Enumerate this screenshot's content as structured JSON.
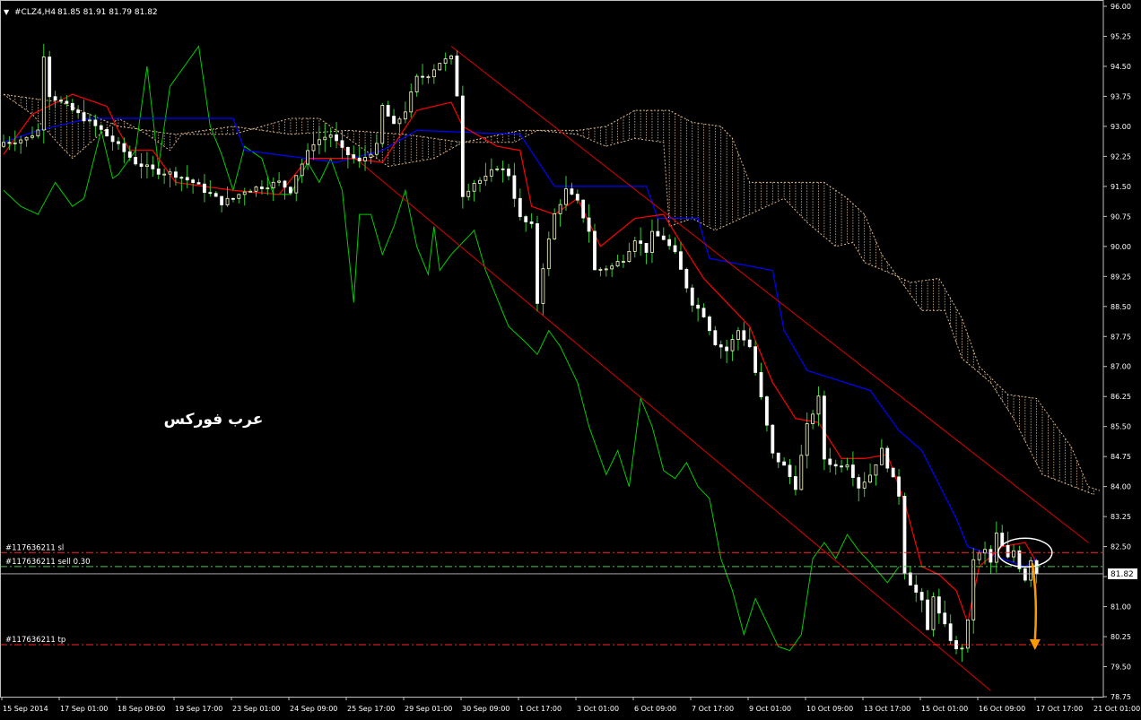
{
  "header": {
    "arrow": "▼",
    "symbol_timeframe": "#CLZ4,H4",
    "ohlc": "81.85 81.91 81.79 81.82"
  },
  "watermark": "عرب فوركس",
  "current_price_label": "81.82",
  "order_labels": {
    "sl": "#117636211 sl",
    "sell": "#117636211 sell 0.30",
    "tp": "#117636211 tp"
  },
  "colors": {
    "background": "#000000",
    "grid_frame": "#c0c0c0",
    "bull_candle": "#ffffcc",
    "bear_candle": "#ffffff",
    "wick": "#33cc33",
    "tenkan": "#ff0000",
    "kijun": "#0000ff",
    "chikou": "#00cc00",
    "cloud": "#d8b48a",
    "channel": "#dd0000",
    "sl_line": "#ff2222",
    "tp_line": "#ff2222",
    "sell_line": "#44cc44",
    "arrow": "#ff9900",
    "circle": "#ffffff"
  },
  "chart_data": {
    "type": "candlestick",
    "instrument": "#CLZ4",
    "timeframe": "H4",
    "ylim": [
      78.75,
      96.0
    ],
    "yticks": [
      "96.00",
      "95.25",
      "94.50",
      "93.75",
      "93.00",
      "92.25",
      "91.50",
      "90.75",
      "90.00",
      "89.25",
      "88.50",
      "87.75",
      "87.00",
      "86.25",
      "85.50",
      "84.75",
      "84.00",
      "83.25",
      "82.50",
      "81.75",
      "81.00",
      "80.25",
      "79.50",
      "78.75"
    ],
    "xticks": [
      "15 Sep 2014",
      "17 Sep 01:00",
      "18 Sep 09:00",
      "19 Sep 17:00",
      "23 Sep 01:00",
      "24 Sep 09:00",
      "25 Sep 17:00",
      "29 Sep 01:00",
      "30 Sep 09:00",
      "1 Oct 17:00",
      "3 Oct 01:00",
      "6 Oct 09:00",
      "7 Oct 17:00",
      "9 Oct 01:00",
      "10 Oct 09:00",
      "13 Oct 17:00",
      "15 Oct 01:00",
      "16 Oct 09:00",
      "17 Oct 17:00",
      "21 Oct 01:00"
    ],
    "bar_count": 192,
    "close_anchors": [
      [
        0,
        92.6
      ],
      [
        4,
        92.7
      ],
      [
        6,
        92.9
      ],
      [
        7,
        94.8
      ],
      [
        8,
        93.8
      ],
      [
        10,
        93.6
      ],
      [
        14,
        93.2
      ],
      [
        17,
        92.9
      ],
      [
        20,
        92.5
      ],
      [
        23,
        92.1
      ],
      [
        26,
        91.9
      ],
      [
        30,
        91.8
      ],
      [
        33,
        91.6
      ],
      [
        36,
        91.3
      ],
      [
        38,
        91.1
      ],
      [
        40,
        91.2
      ],
      [
        42,
        91.4
      ],
      [
        45,
        91.5
      ],
      [
        48,
        91.6
      ],
      [
        50,
        91.4
      ],
      [
        51,
        91.8
      ],
      [
        54,
        92.6
      ],
      [
        57,
        92.8
      ],
      [
        59,
        92.4
      ],
      [
        62,
        92.1
      ],
      [
        65,
        92.5
      ],
      [
        66,
        93.5
      ],
      [
        68,
        93.0
      ],
      [
        70,
        93.4
      ],
      [
        72,
        94.2
      ],
      [
        74,
        94.3
      ],
      [
        76,
        94.6
      ],
      [
        78,
        94.7
      ],
      [
        79,
        93.8
      ],
      [
        80,
        91.3
      ],
      [
        82,
        91.6
      ],
      [
        84,
        91.7
      ],
      [
        86,
        92.0
      ],
      [
        88,
        91.8
      ],
      [
        90,
        90.7
      ],
      [
        92,
        90.5
      ],
      [
        93,
        88.6
      ],
      [
        94,
        89.5
      ],
      [
        96,
        90.8
      ],
      [
        98,
        91.4
      ],
      [
        100,
        91.1
      ],
      [
        102,
        90.4
      ],
      [
        103,
        89.4
      ],
      [
        106,
        89.5
      ],
      [
        108,
        89.7
      ],
      [
        110,
        90.2
      ],
      [
        112,
        89.9
      ],
      [
        113,
        90.3
      ],
      [
        115,
        90.2
      ],
      [
        117,
        89.8
      ],
      [
        118,
        89.4
      ],
      [
        120,
        88.6
      ],
      [
        122,
        88.3
      ],
      [
        124,
        87.6
      ],
      [
        126,
        87.4
      ],
      [
        128,
        87.9
      ],
      [
        130,
        87.5
      ],
      [
        132,
        86.2
      ],
      [
        134,
        84.8
      ],
      [
        136,
        84.5
      ],
      [
        138,
        84.0
      ],
      [
        140,
        85.5
      ],
      [
        142,
        86.2
      ],
      [
        143,
        84.7
      ],
      [
        145,
        84.5
      ],
      [
        147,
        84.6
      ],
      [
        149,
        84.0
      ],
      [
        151,
        84.3
      ],
      [
        153,
        84.9
      ],
      [
        156,
        83.8
      ],
      [
        157,
        81.9
      ],
      [
        158,
        81.6
      ],
      [
        160,
        81.1
      ],
      [
        161,
        80.4
      ],
      [
        162,
        81.3
      ],
      [
        163,
        80.8
      ],
      [
        165,
        80.2
      ],
      [
        166,
        79.9
      ],
      [
        167,
        80.0
      ],
      [
        168,
        80.6
      ],
      [
        169,
        82.2
      ],
      [
        171,
        82.4
      ],
      [
        172,
        82.1
      ],
      [
        173,
        82.8
      ],
      [
        174,
        82.5
      ],
      [
        175,
        82.2
      ],
      [
        176,
        82.4
      ],
      [
        177,
        82.0
      ],
      [
        178,
        81.7
      ],
      [
        179,
        82.2
      ],
      [
        180,
        81.82
      ]
    ],
    "tenkan_anchors": [
      [
        0,
        92.3
      ],
      [
        5,
        93.3
      ],
      [
        12,
        93.8
      ],
      [
        18,
        93.5
      ],
      [
        20,
        92.9
      ],
      [
        22,
        92.4
      ],
      [
        26,
        92.4
      ],
      [
        30,
        91.6
      ],
      [
        35,
        91.5
      ],
      [
        40,
        91.4
      ],
      [
        48,
        91.3
      ],
      [
        53,
        92.2
      ],
      [
        60,
        92.2
      ],
      [
        66,
        92.1
      ],
      [
        72,
        93.4
      ],
      [
        78,
        93.6
      ],
      [
        80,
        93.0
      ],
      [
        86,
        92.5
      ],
      [
        90,
        92.4
      ],
      [
        92,
        91.0
      ],
      [
        96,
        90.8
      ],
      [
        100,
        91.2
      ],
      [
        104,
        90.0
      ],
      [
        110,
        90.7
      ],
      [
        115,
        90.8
      ],
      [
        118,
        90.1
      ],
      [
        122,
        89.2
      ],
      [
        126,
        88.6
      ],
      [
        130,
        88.0
      ],
      [
        134,
        86.6
      ],
      [
        138,
        85.7
      ],
      [
        142,
        85.6
      ],
      [
        146,
        84.7
      ],
      [
        150,
        84.7
      ],
      [
        154,
        84.8
      ],
      [
        157,
        83.6
      ],
      [
        160,
        82.0
      ],
      [
        163,
        81.8
      ],
      [
        166,
        81.4
      ],
      [
        168,
        80.6
      ],
      [
        170,
        82.0
      ],
      [
        174,
        82.5
      ],
      [
        178,
        82.6
      ],
      [
        180,
        82.1
      ]
    ],
    "kijun_anchors": [
      [
        0,
        92.6
      ],
      [
        6,
        92.9
      ],
      [
        15,
        93.2
      ],
      [
        40,
        93.2
      ],
      [
        42,
        92.4
      ],
      [
        58,
        92.1
      ],
      [
        66,
        92.4
      ],
      [
        72,
        92.9
      ],
      [
        90,
        92.8
      ],
      [
        96,
        91.5
      ],
      [
        112,
        91.5
      ],
      [
        114,
        90.7
      ],
      [
        121,
        90.7
      ],
      [
        123,
        89.7
      ],
      [
        134,
        89.4
      ],
      [
        136,
        87.9
      ],
      [
        140,
        86.9
      ],
      [
        151,
        86.4
      ],
      [
        156,
        85.4
      ],
      [
        160,
        84.9
      ],
      [
        166,
        83.2
      ],
      [
        168,
        82.5
      ],
      [
        172,
        82.3
      ],
      [
        178,
        82.0
      ],
      [
        180,
        82.2
      ]
    ],
    "chikou_anchors": [
      [
        0,
        91.4
      ],
      [
        3,
        91.0
      ],
      [
        6,
        90.8
      ],
      [
        9,
        91.6
      ],
      [
        12,
        91.0
      ],
      [
        14,
        91.2
      ],
      [
        17,
        92.9
      ],
      [
        19,
        91.7
      ],
      [
        20,
        91.8
      ],
      [
        23,
        92.4
      ],
      [
        25,
        94.5
      ],
      [
        27,
        92.0
      ],
      [
        29,
        94.0
      ],
      [
        31,
        94.4
      ],
      [
        34,
        95.0
      ],
      [
        36,
        93.0
      ],
      [
        38,
        92.3
      ],
      [
        40,
        91.4
      ],
      [
        42,
        92.5
      ],
      [
        45,
        92.2
      ],
      [
        47,
        91.3
      ],
      [
        50,
        91.3
      ],
      [
        53,
        92.1
      ],
      [
        55,
        91.6
      ],
      [
        57,
        92.2
      ],
      [
        59,
        91.4
      ],
      [
        61,
        88.6
      ],
      [
        62,
        90.8
      ],
      [
        64,
        90.8
      ],
      [
        66,
        89.8
      ],
      [
        68,
        90.5
      ],
      [
        70,
        91.4
      ],
      [
        72,
        90.0
      ],
      [
        74,
        89.3
      ],
      [
        75,
        90.5
      ],
      [
        76,
        89.4
      ],
      [
        78,
        89.8
      ],
      [
        80,
        90.1
      ],
      [
        82,
        90.4
      ],
      [
        84,
        89.4
      ],
      [
        86,
        88.7
      ],
      [
        88,
        88.0
      ],
      [
        91,
        87.6
      ],
      [
        93,
        87.3
      ],
      [
        95,
        87.9
      ],
      [
        97,
        87.5
      ],
      [
        100,
        86.6
      ],
      [
        102,
        85.5
      ],
      [
        105,
        84.3
      ],
      [
        107,
        84.9
      ],
      [
        109,
        84.0
      ],
      [
        111,
        86.2
      ],
      [
        113,
        85.5
      ],
      [
        115,
        84.4
      ],
      [
        117,
        84.2
      ],
      [
        119,
        84.6
      ],
      [
        121,
        84.0
      ],
      [
        123,
        83.7
      ],
      [
        125,
        82.2
      ],
      [
        127,
        81.4
      ],
      [
        129,
        80.3
      ],
      [
        131,
        81.2
      ],
      [
        133,
        80.6
      ],
      [
        135,
        80.0
      ],
      [
        137,
        79.9
      ],
      [
        139,
        80.3
      ],
      [
        141,
        82.2
      ],
      [
        143,
        82.6
      ],
      [
        145,
        82.2
      ],
      [
        147,
        82.8
      ],
      [
        149,
        82.4
      ],
      [
        151,
        82.1
      ],
      [
        154,
        81.6
      ],
      [
        156,
        82.0
      ]
    ],
    "span_a_anchors": [
      [
        0,
        93.8
      ],
      [
        10,
        93.6
      ],
      [
        20,
        93.0
      ],
      [
        30,
        92.8
      ],
      [
        40,
        93.0
      ],
      [
        50,
        92.8
      ],
      [
        60,
        92.9
      ],
      [
        70,
        92.8
      ],
      [
        80,
        92.6
      ],
      [
        90,
        92.9
      ],
      [
        100,
        92.9
      ],
      [
        105,
        93.0
      ],
      [
        110,
        93.4
      ],
      [
        116,
        93.4
      ],
      [
        120,
        93.1
      ],
      [
        125,
        93.0
      ],
      [
        127,
        92.7
      ],
      [
        130,
        91.6
      ],
      [
        143,
        91.6
      ],
      [
        147,
        91.2
      ],
      [
        150,
        90.8
      ],
      [
        153,
        89.8
      ],
      [
        156,
        89.2
      ],
      [
        160,
        88.4
      ],
      [
        164,
        88.4
      ],
      [
        167,
        87.2
      ],
      [
        172,
        86.6
      ],
      [
        176,
        85.7
      ],
      [
        181,
        84.3
      ],
      [
        190,
        83.8
      ]
    ],
    "span_b_anchors": [
      [
        0,
        93.8
      ],
      [
        5,
        93.3
      ],
      [
        10,
        92.5
      ],
      [
        12,
        92.2
      ],
      [
        20,
        93.2
      ],
      [
        25,
        92.8
      ],
      [
        29,
        92.4
      ],
      [
        31,
        92.8
      ],
      [
        40,
        92.8
      ],
      [
        50,
        93.2
      ],
      [
        55,
        93.2
      ],
      [
        60,
        92.7
      ],
      [
        67,
        92.0
      ],
      [
        75,
        92.2
      ],
      [
        80,
        92.6
      ],
      [
        89,
        92.6
      ],
      [
        93,
        92.9
      ],
      [
        100,
        92.8
      ],
      [
        105,
        92.5
      ],
      [
        110,
        92.7
      ],
      [
        115,
        92.6
      ],
      [
        116,
        90.5
      ],
      [
        120,
        90.7
      ],
      [
        124,
        90.4
      ],
      [
        130,
        90.8
      ],
      [
        136,
        91.2
      ],
      [
        140,
        90.6
      ],
      [
        145,
        90.0
      ],
      [
        148,
        90.1
      ],
      [
        150,
        89.6
      ],
      [
        155,
        89.3
      ],
      [
        158,
        89.1
      ],
      [
        163,
        89.2
      ],
      [
        167,
        88.2
      ],
      [
        170,
        87.0
      ],
      [
        175,
        86.3
      ],
      [
        180,
        86.2
      ],
      [
        186,
        85.0
      ],
      [
        189,
        84.0
      ],
      [
        191,
        83.9
      ]
    ],
    "channel_lines": {
      "upper": [
        [
          78,
          95.0
        ],
        [
          189,
          82.6
        ]
      ],
      "lower": [
        [
          58,
          92.6
        ],
        [
          172,
          78.9
        ]
      ]
    },
    "order_levels": {
      "sl": 82.35,
      "sell": 82.0,
      "tp": 80.05,
      "bid": 81.82
    }
  }
}
